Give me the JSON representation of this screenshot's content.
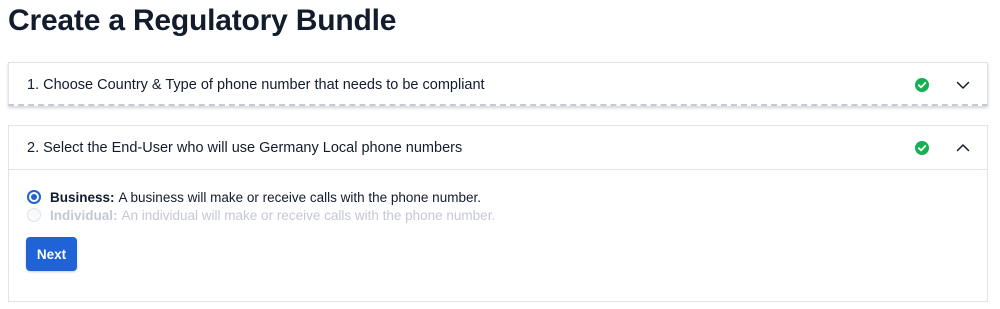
{
  "page": {
    "title": "Create a Regulatory Bundle"
  },
  "steps": [
    {
      "label": "1. Choose Country & Type of phone number that needs to be compliant",
      "status": "complete",
      "expanded": false
    },
    {
      "label": "2. Select the End-User who will use Germany Local phone numbers",
      "status": "complete",
      "expanded": true,
      "options": [
        {
          "title": "Business:",
          "description": "A business will make or receive calls with the phone number.",
          "selected": true,
          "disabled": false
        },
        {
          "title": "Individual:",
          "description": "An individual will make or receive calls with the phone number.",
          "selected": false,
          "disabled": true
        }
      ],
      "next_label": "Next"
    }
  ],
  "colors": {
    "accent": "#1f63d6",
    "success": "#14b053",
    "text": "#121c2d"
  },
  "icons": {
    "complete": "check-circle-icon",
    "collapsed": "chevron-down-icon",
    "expanded": "chevron-up-icon"
  }
}
